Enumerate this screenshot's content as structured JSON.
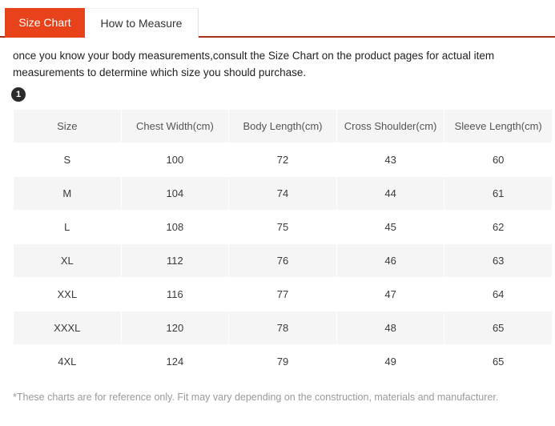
{
  "tabs": [
    {
      "label": "Size Chart",
      "active": true
    },
    {
      "label": "How to Measure",
      "active": false
    }
  ],
  "intro_text": "once you know your body measurements,consult the Size Chart on the product pages for actual item measurements to determine which size you should purchase.",
  "step_badge": "1",
  "table": {
    "headers": [
      "Size",
      "Chest Width(cm)",
      "Body Length(cm)",
      "Cross Shoulder(cm)",
      "Sleeve Length(cm)"
    ],
    "rows": [
      [
        "S",
        "100",
        "72",
        "43",
        "60"
      ],
      [
        "M",
        "104",
        "74",
        "44",
        "61"
      ],
      [
        "L",
        "108",
        "75",
        "45",
        "62"
      ],
      [
        "XL",
        "112",
        "76",
        "46",
        "63"
      ],
      [
        "XXL",
        "116",
        "77",
        "47",
        "64"
      ],
      [
        "XXXL",
        "120",
        "78",
        "48",
        "65"
      ],
      [
        "4XL",
        "124",
        "79",
        "49",
        "65"
      ]
    ]
  },
  "footnote": "*These charts are for reference only. Fit may vary depending on the construction, materials and manufacturer.",
  "colors": {
    "active_tab_bg": "#e8421a",
    "tab_underline": "#a8301a",
    "row_shade": "#f5f5f5",
    "badge_bg": "#2b2b2b",
    "footnote_text": "#9a9a9a"
  }
}
